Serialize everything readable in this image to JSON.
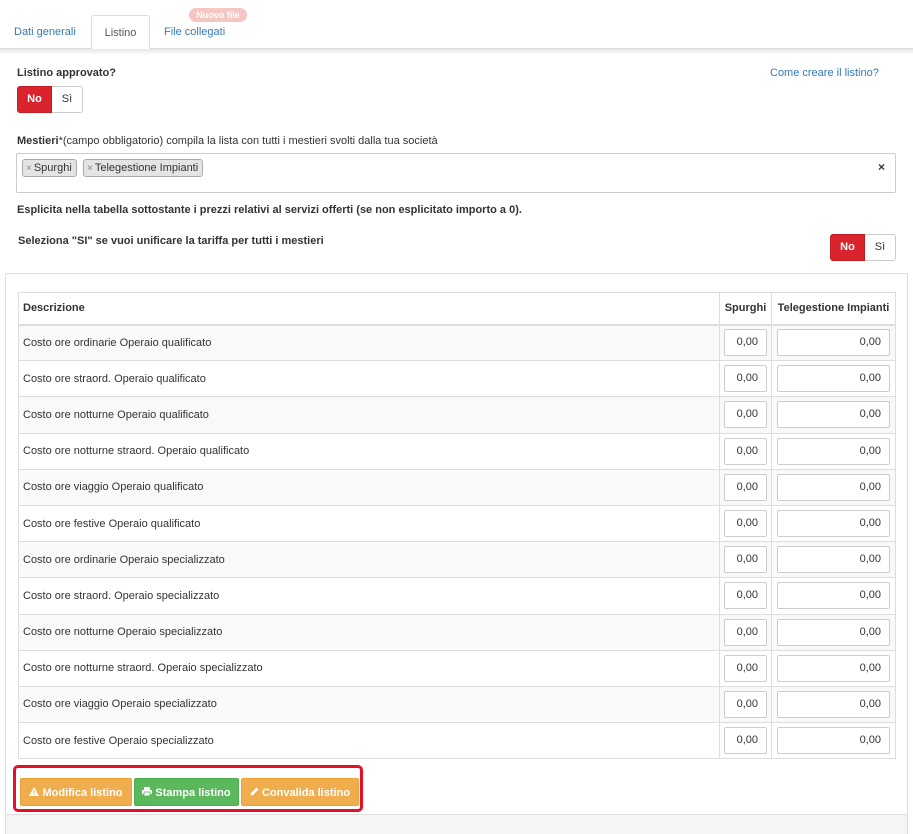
{
  "tabs": [
    {
      "label": "Dati generali"
    },
    {
      "label": "Listino"
    },
    {
      "label": "File collegati"
    }
  ],
  "new_badge": "Nuovo file",
  "listino_approvato": {
    "label": "Listino approvato?",
    "no": "No",
    "si": "Sì",
    "selected": "No"
  },
  "help_link": "Come creare il listino?",
  "mestieri": {
    "label_bold": "Mestieri",
    "label_rest": "*(campo obbligatorio) compila la lista con tutti i mestieri svolti dalla tua società",
    "tags": [
      "Spurghi",
      "Telegestione Impianti"
    ],
    "tag_remove_glyph": "×",
    "clear_glyph": "×"
  },
  "instruction": "Esplicita nella tabella sottostante i prezzi relativi al servizi offerti (se non esplicitato importo a 0).",
  "unifica": {
    "label": "Seleziona \"SI\" se vuoi unificare la tariffa per tutti i mestieri",
    "no": "No",
    "si": "Sì",
    "selected": "No"
  },
  "table": {
    "headers": [
      "Descrizione",
      "Spurghi",
      "Telegestione Impianti"
    ],
    "rows": [
      {
        "desc": "Costo ore ordinarie Operaio qualificato",
        "spurghi": "0,00",
        "telegestione": "0,00"
      },
      {
        "desc": "Costo ore straord. Operaio qualificato",
        "spurghi": "0,00",
        "telegestione": "0,00"
      },
      {
        "desc": "Costo ore notturne Operaio qualificato",
        "spurghi": "0,00",
        "telegestione": "0,00"
      },
      {
        "desc": "Costo ore notturne straord. Operaio qualificato",
        "spurghi": "0,00",
        "telegestione": "0,00"
      },
      {
        "desc": "Costo ore viaggio Operaio qualificato",
        "spurghi": "0,00",
        "telegestione": "0,00"
      },
      {
        "desc": "Costo ore festive Operaio qualificato",
        "spurghi": "0,00",
        "telegestione": "0,00"
      },
      {
        "desc": "Costo ore ordinarie Operaio specializzato",
        "spurghi": "0,00",
        "telegestione": "0,00"
      },
      {
        "desc": "Costo ore straord. Operaio specializzato",
        "spurghi": "0,00",
        "telegestione": "0,00"
      },
      {
        "desc": "Costo ore notturne Operaio specializzato",
        "spurghi": "0,00",
        "telegestione": "0,00"
      },
      {
        "desc": "Costo ore notturne straord. Operaio specializzato",
        "spurghi": "0,00",
        "telegestione": "0,00"
      },
      {
        "desc": "Costo ore viaggio Operaio specializzato",
        "spurghi": "0,00",
        "telegestione": "0,00"
      },
      {
        "desc": "Costo ore festive Operaio specializzato",
        "spurghi": "0,00",
        "telegestione": "0,00"
      }
    ]
  },
  "buttons": {
    "modifica": "Modifica listino",
    "stampa": "Stampa listino",
    "convalida": "Convalida listino"
  },
  "colors": {
    "toggle_on": "#d9232d",
    "link": "#337ab7",
    "btn_orange": "#f0ad4e",
    "btn_green": "#5cb85c",
    "highlight_border": "#e4102a"
  }
}
